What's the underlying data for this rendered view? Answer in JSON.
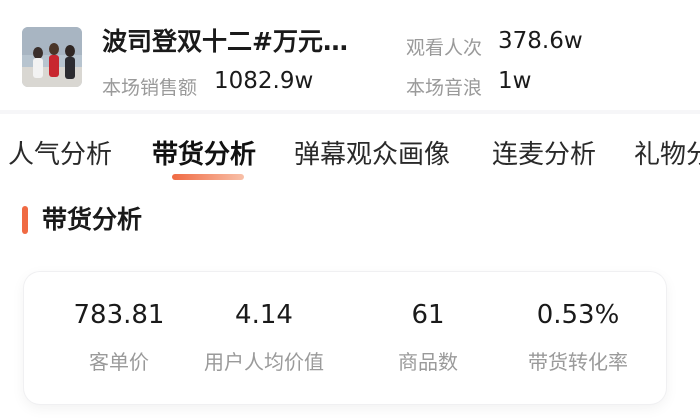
{
  "header": {
    "title": "波司登双十二#万元…",
    "metrics": [
      {
        "label": "观看人次",
        "value": "378.6w"
      },
      {
        "label": "本场销售额",
        "value": "1082.9w"
      },
      {
        "label": "本场音浪",
        "value": "1w"
      }
    ]
  },
  "tabs": [
    {
      "label": "人气分析"
    },
    {
      "label": "带货分析"
    },
    {
      "label": "弹幕观众画像"
    },
    {
      "label": "连麦分析"
    },
    {
      "label": "礼物分"
    }
  ],
  "active_tab": "带货分析",
  "section": {
    "title": "带货分析"
  },
  "stats": [
    {
      "value": "783.81",
      "label": "客单价"
    },
    {
      "value": "4.14",
      "label": "用户人均价值"
    },
    {
      "value": "61",
      "label": "商品数"
    },
    {
      "value": "0.53%",
      "label": "带货转化率"
    }
  ],
  "colors": {
    "accent": "#f06a43",
    "muted_text": "#9a9a9a",
    "primary_text": "#1a1a1a"
  }
}
